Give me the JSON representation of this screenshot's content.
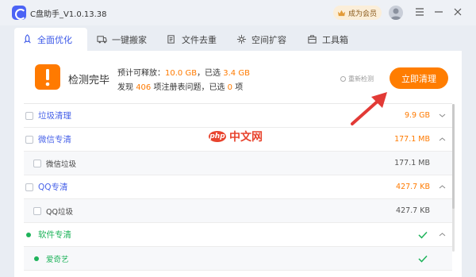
{
  "window": {
    "title": "C盘助手_V1.0.13.38",
    "vip_label": "成为会员"
  },
  "tabs": [
    {
      "label": "全面优化",
      "icon": "rocket-icon",
      "active": true
    },
    {
      "label": "一键搬家",
      "icon": "truck-icon",
      "active": false
    },
    {
      "label": "文件去重",
      "icon": "files-icon",
      "active": false
    },
    {
      "label": "空间扩容",
      "icon": "sparkle-icon",
      "active": false
    },
    {
      "label": "工具箱",
      "icon": "toolbox-icon",
      "active": false
    }
  ],
  "summary": {
    "title": "检测完毕",
    "line1": {
      "prefix": "预计可释放：",
      "releasable": "10.0 GB",
      "mid": "，已选",
      "selected": "3.4 GB"
    },
    "line2": {
      "prefix": "发现",
      "count": "406",
      "mid": "项注册表问题，已选",
      "selected_count": "0",
      "suffix": "项"
    },
    "recheck_label": "重新检测",
    "clean_button": "立即清理"
  },
  "rows": [
    {
      "label": "垃圾清理",
      "size": "9.9 GB",
      "kind": "cat",
      "marker": "checkbox",
      "expanded": false
    },
    {
      "label": "微信专清",
      "size": "177.1 MB",
      "kind": "cat",
      "marker": "checkbox",
      "expanded": true
    },
    {
      "label": "微信垃圾",
      "size": "177.1 MB",
      "kind": "sub",
      "marker": "checkbox",
      "expanded": false
    },
    {
      "label": "QQ专清",
      "size": "427.7 KB",
      "kind": "cat",
      "marker": "checkbox",
      "expanded": true
    },
    {
      "label": "QQ垃圾",
      "size": "427.7 KB",
      "kind": "sub",
      "marker": "checkbox",
      "expanded": false
    },
    {
      "label": "软件专清",
      "size": "",
      "kind": "cat",
      "marker": "dot",
      "expanded": true,
      "done": true
    },
    {
      "label": "爱奇艺",
      "size": "",
      "kind": "sub",
      "marker": "dot",
      "expanded": false,
      "done": true
    }
  ],
  "watermark": {
    "logo": "php",
    "text": "中文网"
  },
  "colors": {
    "accent_blue": "#3a57e8",
    "orange": "#ff7d00",
    "green": "#1eb35a",
    "arrow_red": "#e23a36"
  }
}
